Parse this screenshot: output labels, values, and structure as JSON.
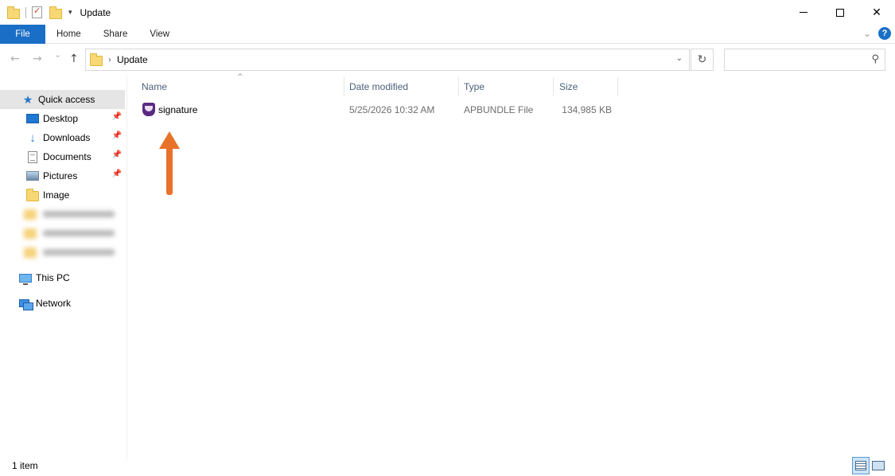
{
  "window": {
    "title": "Update"
  },
  "quick_access_toolbar": {
    "icons": [
      "folder-icon",
      "properties-icon",
      "new-folder-icon",
      "customize-dropdown-icon"
    ]
  },
  "window_controls": {
    "minimize": "—",
    "maximize": "☐",
    "close": "✕"
  },
  "ribbon": {
    "tabs": [
      {
        "label": "File"
      },
      {
        "label": "Home"
      },
      {
        "label": "Share"
      },
      {
        "label": "View"
      }
    ],
    "accent": "#1a6ec6"
  },
  "navigation": {
    "back": "←",
    "forward": "→",
    "recent": "⌄",
    "up": "↑"
  },
  "address": {
    "crumbs": [
      "Update"
    ],
    "separator": "›"
  },
  "search": {
    "placeholder": ""
  },
  "nav_pane": {
    "quick_access": "Quick access",
    "items": [
      {
        "label": "Desktop",
        "pinned": true
      },
      {
        "label": "Downloads",
        "pinned": true
      },
      {
        "label": "Documents",
        "pinned": true
      },
      {
        "label": "Pictures",
        "pinned": true
      },
      {
        "label": "Image",
        "pinned": false
      }
    ],
    "this_pc": "This PC",
    "network": "Network"
  },
  "columns": {
    "name": "Name",
    "date": "Date modified",
    "type": "Type",
    "size": "Size"
  },
  "files": [
    {
      "name": "signature",
      "date": "5/25/2026 10:32 AM",
      "type": "APBUNDLE File",
      "size": "134,985 KB"
    }
  ],
  "annotation": {
    "color": "#e8722a"
  },
  "status": {
    "count": "1 item"
  }
}
